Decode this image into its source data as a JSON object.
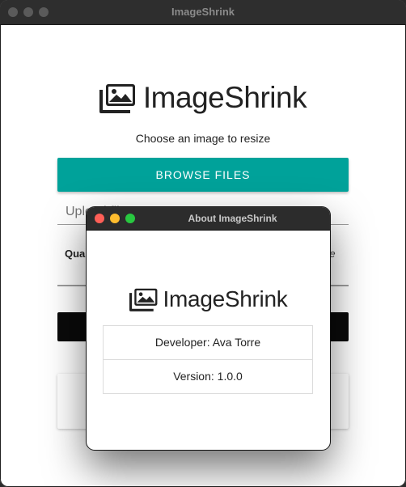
{
  "main_window": {
    "title": "ImageShrink",
    "logo_text": "ImageShrink",
    "subtitle": "Choose an image to resize",
    "browse_button": "BROWSE FILES",
    "upload_placeholder": "Upload file",
    "quality_label": "Qua",
    "quality_suffix": "ize"
  },
  "about_dialog": {
    "title": "About ImageShrink",
    "logo_text": "ImageShrink",
    "developer": "Developer: Ava Torre",
    "version": "Version: 1.0.0"
  },
  "colors": {
    "accent": "#00a29a",
    "titlebar": "#2e2e2e",
    "close": "#ff5f57",
    "minimize": "#febc2e",
    "maximize": "#28c840"
  }
}
